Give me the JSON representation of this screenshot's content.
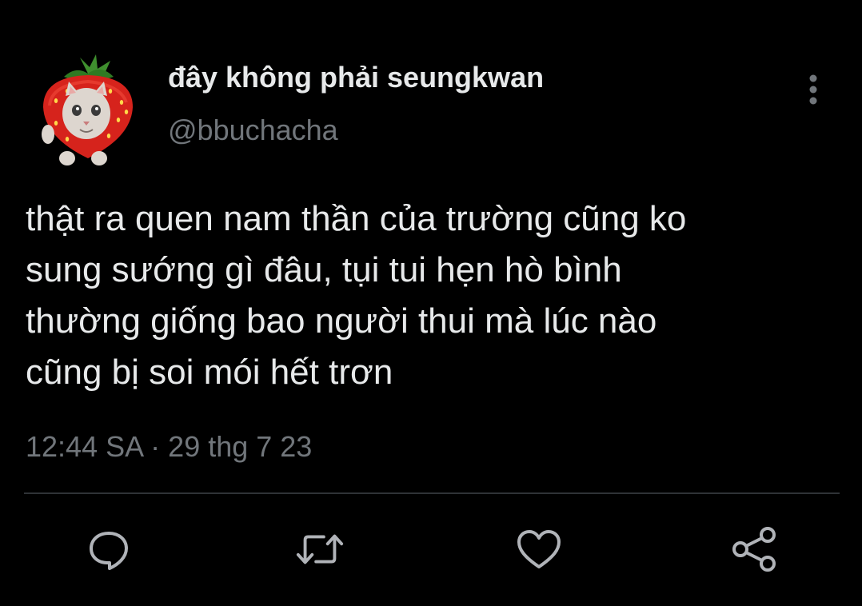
{
  "tweet": {
    "display_name": "đây không phải seungkwan",
    "handle": "@bbuchacha",
    "avatar_icon": "strawberry-cat-avatar",
    "text_lines": [
      "thật ra quen nam thần của trường cũng ko",
      "sung sướng gì đâu, tụi tui hẹn hò bình",
      "thường giống bao người thui mà lúc nào",
      "cũng bị soi mói hết trơn"
    ],
    "time": "12:44 SA",
    "separator": "·",
    "date": "29 thg 7 23"
  },
  "actions": {
    "reply_icon": "reply-bubble-icon",
    "retweet_icon": "retweet-icon",
    "like_icon": "heart-icon",
    "share_icon": "share-icon"
  },
  "colors": {
    "background": "#000000",
    "primary_text": "#e7e9ea",
    "secondary_text": "#71767b",
    "icon": "#b0b3b8",
    "divider": "#2f3336"
  }
}
